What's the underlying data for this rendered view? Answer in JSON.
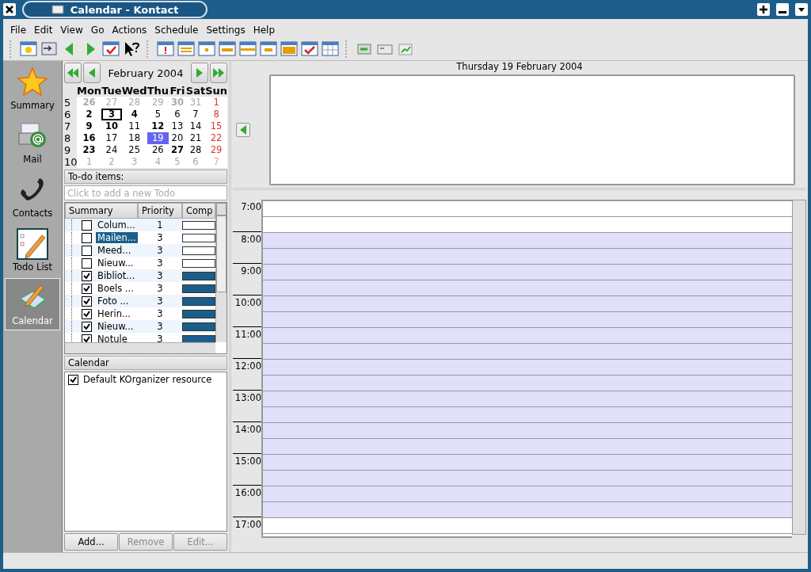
{
  "window": {
    "title": "Calendar - Kontact"
  },
  "menu": [
    "File",
    "Edit",
    "View",
    "Go",
    "Actions",
    "Schedule",
    "Settings",
    "Help"
  ],
  "sidebar": [
    {
      "label": "Summary",
      "selected": false
    },
    {
      "label": "Mail",
      "selected": false
    },
    {
      "label": "Contacts",
      "selected": false
    },
    {
      "label": "Todo List",
      "selected": false
    },
    {
      "label": "Calendar",
      "selected": true
    }
  ],
  "date_navigator": {
    "month": "February 2004",
    "weekdays": [
      "Mon",
      "Tue",
      "Wed",
      "Thu",
      "Fri",
      "Sat",
      "Sun"
    ],
    "weeks": [
      {
        "number": "5",
        "days": [
          {
            "n": "26",
            "out": true,
            "events": true,
            "selected": false,
            "today": false
          },
          {
            "n": "27",
            "out": true,
            "events": false,
            "selected": false,
            "today": false
          },
          {
            "n": "28",
            "out": true,
            "events": false,
            "selected": false,
            "today": false
          },
          {
            "n": "29",
            "out": true,
            "events": false,
            "selected": false,
            "today": false
          },
          {
            "n": "30",
            "out": true,
            "events": true,
            "selected": false,
            "today": false
          },
          {
            "n": "31",
            "out": true,
            "events": false,
            "selected": false,
            "today": false
          },
          {
            "n": "1",
            "out": false,
            "events": false,
            "selected": false,
            "today": false
          }
        ]
      },
      {
        "number": "6",
        "days": [
          {
            "n": "2",
            "out": false,
            "events": true,
            "selected": false,
            "today": false
          },
          {
            "n": "3",
            "out": false,
            "events": true,
            "selected": false,
            "today": true
          },
          {
            "n": "4",
            "out": false,
            "events": true,
            "selected": false,
            "today": false
          },
          {
            "n": "5",
            "out": false,
            "events": false,
            "selected": false,
            "today": false
          },
          {
            "n": "6",
            "out": false,
            "events": false,
            "selected": false,
            "today": false
          },
          {
            "n": "7",
            "out": false,
            "events": false,
            "selected": false,
            "today": false
          },
          {
            "n": "8",
            "out": false,
            "events": false,
            "selected": false,
            "today": false
          }
        ]
      },
      {
        "number": "7",
        "days": [
          {
            "n": "9",
            "out": false,
            "events": true,
            "selected": false,
            "today": false
          },
          {
            "n": "10",
            "out": false,
            "events": true,
            "selected": false,
            "today": false
          },
          {
            "n": "11",
            "out": false,
            "events": false,
            "selected": false,
            "today": false
          },
          {
            "n": "12",
            "out": false,
            "events": true,
            "selected": false,
            "today": false
          },
          {
            "n": "13",
            "out": false,
            "events": false,
            "selected": false,
            "today": false
          },
          {
            "n": "14",
            "out": false,
            "events": false,
            "selected": false,
            "today": false
          },
          {
            "n": "15",
            "out": false,
            "events": false,
            "selected": false,
            "today": false
          }
        ]
      },
      {
        "number": "8",
        "days": [
          {
            "n": "16",
            "out": false,
            "events": true,
            "selected": false,
            "today": false
          },
          {
            "n": "17",
            "out": false,
            "events": false,
            "selected": false,
            "today": false
          },
          {
            "n": "18",
            "out": false,
            "events": false,
            "selected": false,
            "today": false
          },
          {
            "n": "19",
            "out": false,
            "events": false,
            "selected": true,
            "today": false
          },
          {
            "n": "20",
            "out": false,
            "events": false,
            "selected": false,
            "today": false
          },
          {
            "n": "21",
            "out": false,
            "events": false,
            "selected": false,
            "today": false
          },
          {
            "n": "22",
            "out": false,
            "events": false,
            "selected": false,
            "today": false
          }
        ]
      },
      {
        "number": "9",
        "days": [
          {
            "n": "23",
            "out": false,
            "events": true,
            "selected": false,
            "today": false
          },
          {
            "n": "24",
            "out": false,
            "events": false,
            "selected": false,
            "today": false
          },
          {
            "n": "25",
            "out": false,
            "events": false,
            "selected": false,
            "today": false
          },
          {
            "n": "26",
            "out": false,
            "events": false,
            "selected": false,
            "today": false
          },
          {
            "n": "27",
            "out": false,
            "events": true,
            "selected": false,
            "today": false
          },
          {
            "n": "28",
            "out": false,
            "events": false,
            "selected": false,
            "today": false
          },
          {
            "n": "29",
            "out": false,
            "events": false,
            "selected": false,
            "today": false
          }
        ]
      },
      {
        "number": "10",
        "days": [
          {
            "n": "1",
            "out": true,
            "events": false,
            "selected": false,
            "today": false
          },
          {
            "n": "2",
            "out": true,
            "events": false,
            "selected": false,
            "today": false
          },
          {
            "n": "3",
            "out": true,
            "events": false,
            "selected": false,
            "today": false
          },
          {
            "n": "4",
            "out": true,
            "events": false,
            "selected": false,
            "today": false
          },
          {
            "n": "5",
            "out": true,
            "events": false,
            "selected": false,
            "today": false
          },
          {
            "n": "6",
            "out": true,
            "events": false,
            "selected": false,
            "today": false
          },
          {
            "n": "7",
            "out": true,
            "events": false,
            "selected": false,
            "today": false
          }
        ]
      }
    ]
  },
  "todo": {
    "title": "To-do items:",
    "placeholder": "Click to add a new Todo",
    "columns": [
      "Summary",
      "Priority",
      "Comp"
    ],
    "rows": [
      {
        "summary": "Colum...",
        "priority": "1",
        "checked": false,
        "level": 0,
        "selected": false
      },
      {
        "summary": "Mailen...",
        "priority": "3",
        "checked": false,
        "level": 0,
        "selected": true
      },
      {
        "summary": "Meed...",
        "priority": "3",
        "checked": false,
        "level": 0,
        "selected": false
      },
      {
        "summary": "Nieuw...",
        "priority": "3",
        "checked": false,
        "level": 0,
        "selected": false
      },
      {
        "summary": "Bibliot...",
        "priority": "3",
        "checked": true,
        "level": 1,
        "selected": false
      },
      {
        "summary": "Boels ...",
        "priority": "3",
        "checked": true,
        "level": 1,
        "selected": false
      },
      {
        "summary": "Foto ...",
        "priority": "3",
        "checked": true,
        "level": 1,
        "selected": false
      },
      {
        "summary": "Herin...",
        "priority": "3",
        "checked": true,
        "level": 1,
        "selected": false
      },
      {
        "summary": "Nieuw...",
        "priority": "3",
        "checked": true,
        "level": 1,
        "selected": false
      },
      {
        "summary": "Notule",
        "priority": "3",
        "checked": true,
        "level": 1,
        "selected": false
      }
    ]
  },
  "calendars": {
    "title": "Calendar",
    "items": [
      {
        "label": "Default KOrganizer resource",
        "checked": true
      }
    ],
    "buttons": [
      {
        "label": "Add...",
        "disabled": false
      },
      {
        "label": "Remove",
        "disabled": true
      },
      {
        "label": "Edit...",
        "disabled": true
      }
    ]
  },
  "day_view": {
    "date": "Thursday 19 February 2004",
    "hours": [
      {
        "label": "7:00",
        "working": false
      },
      {
        "label": "8:00",
        "working": true
      },
      {
        "label": "9:00",
        "working": true
      },
      {
        "label": "10:00",
        "working": true
      },
      {
        "label": "11:00",
        "working": true
      },
      {
        "label": "12:00",
        "working": true
      },
      {
        "label": "13:00",
        "working": true
      },
      {
        "label": "14:00",
        "working": true
      },
      {
        "label": "15:00",
        "working": true
      },
      {
        "label": "16:00",
        "working": true
      },
      {
        "label": "17:00",
        "working": false
      }
    ]
  }
}
